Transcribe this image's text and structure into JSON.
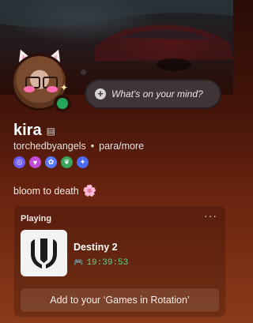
{
  "composer": {
    "placeholder": "What's on your mind?",
    "icon": "plus-circle-icon"
  },
  "profile": {
    "display_name": "kira",
    "username": "torchedbyangels",
    "separator": "•",
    "pronouns": "para/more",
    "status_color": "#23a55a",
    "badges": [
      {
        "name": "nitro-badge",
        "color": "#6d5cf6",
        "glyph": "◎"
      },
      {
        "name": "gem-badge",
        "color": "#c44bd6",
        "glyph": "▼"
      },
      {
        "name": "hypesquad-badge",
        "color": "#5b7bff",
        "glyph": "✿"
      },
      {
        "name": "leaf-badge",
        "color": "#3aa55d",
        "glyph": "❦"
      },
      {
        "name": "quest-badge",
        "color": "#4d6cf6",
        "glyph": "✦"
      }
    ],
    "bio": "bloom to death",
    "bio_emoji": "🌸"
  },
  "activity": {
    "header": "Playing",
    "more": "···",
    "game_title": "Destiny 2",
    "elapsed": "19:39:53",
    "action_label": "Add to your ‘Games in Rotation’"
  }
}
